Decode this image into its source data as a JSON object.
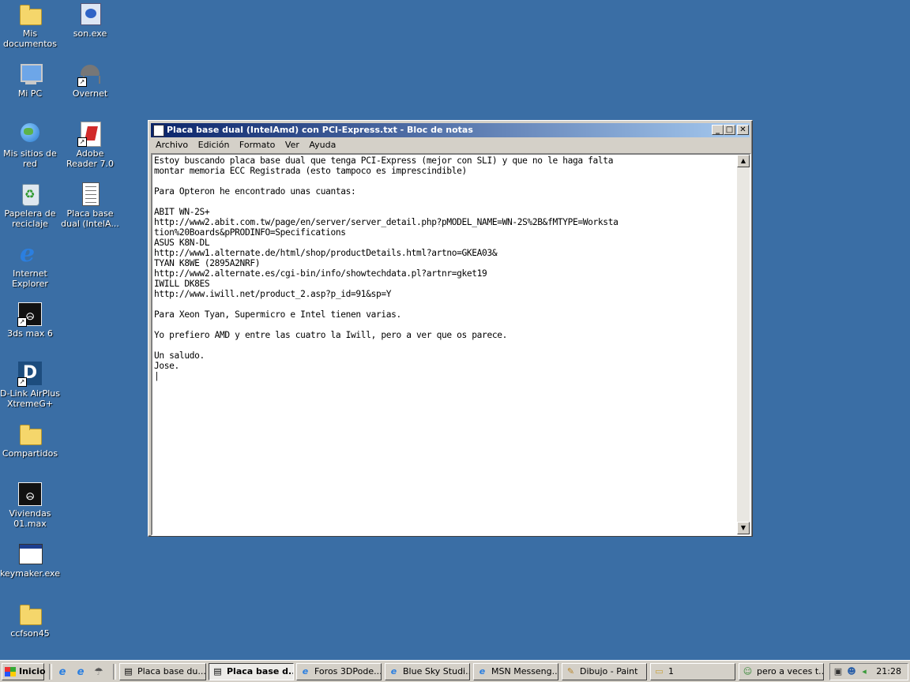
{
  "desktop_icons": [
    {
      "label": "Mis documentos",
      "icon": "folder-documents-icon"
    },
    {
      "label": "son.exe",
      "icon": "exe-icon"
    },
    {
      "label": "Mi PC",
      "icon": "computer-icon"
    },
    {
      "label": "Overnet",
      "icon": "overnet-icon"
    },
    {
      "label": "Mis sitios de red",
      "icon": "network-places-icon"
    },
    {
      "label": "Adobe Reader 7.0",
      "icon": "adobe-reader-icon"
    },
    {
      "label": "Papelera de reciclaje",
      "icon": "recycle-bin-icon"
    },
    {
      "label": "Placa base dual (IntelA...",
      "icon": "text-document-icon"
    },
    {
      "label": "Internet Explorer",
      "icon": "internet-explorer-icon"
    },
    {
      "label": "3ds max 6",
      "icon": "3ds-max-icon"
    },
    {
      "label": "D-Link AirPlus XtremeG+",
      "icon": "dlink-icon"
    },
    {
      "label": "Compartidos",
      "icon": "folder-icon"
    },
    {
      "label": "Viviendas 01.max",
      "icon": "max-file-icon"
    },
    {
      "label": "keymaker.exe",
      "icon": "application-icon"
    },
    {
      "label": "ccfson45",
      "icon": "folder-icon"
    }
  ],
  "window": {
    "title": "Placa base dual (IntelAmd) con PCI-Express.txt - Bloc de notas",
    "minimize_symbol": "_",
    "maximize_symbol": "□",
    "close_symbol": "✕",
    "menu": [
      "Archivo",
      "Edición",
      "Formato",
      "Ver",
      "Ayuda"
    ],
    "content": "Estoy buscando placa base dual que tenga PCI-Express (mejor con SLI) y que no le haga falta\nmontar memoria ECC Registrada (esto tampoco es imprescindible)\n\nPara Opteron he encontrado unas cuantas:\n\nABIT WN-2S+\nhttp://www2.abit.com.tw/page/en/server/server_detail.php?pMODEL_NAME=WN-2S%2B&fMTYPE=Worksta\ntion%20Boards&pPRODINFO=Specifications\nASUS K8N-DL\nhttp://www1.alternate.de/html/shop/productDetails.html?artno=GKEA03&\nTYAN K8WE (2895A2NRF)\nhttp://www2.alternate.es/cgi-bin/info/showtechdata.pl?artnr=gket19\nIWILL DK8ES\nhttp://www.iwill.net/product_2.asp?p_id=91&sp=Y\n\nPara Xeon Tyan, Supermicro e Intel tienen varias.\n\nYo prefiero AMD y entre las cuatro la Iwill, pero a ver que os parece.\n\nUn saludo.\nJose.\n|",
    "scroll_up_symbol": "▲",
    "scroll_down_symbol": "▼"
  },
  "taskbar": {
    "start_label": "Inicio",
    "quick_launch": [
      {
        "icon": "internet-explorer-icon",
        "glyph": "e"
      },
      {
        "icon": "browser-icon",
        "glyph": "e"
      },
      {
        "icon": "overnet-icon",
        "glyph": "☂"
      }
    ],
    "tasks": [
      {
        "label": "Placa base du...",
        "icon": "notepad-icon",
        "glyph": "▤",
        "active": false
      },
      {
        "label": "Placa base d...",
        "icon": "notepad-icon",
        "glyph": "▤",
        "active": true
      },
      {
        "label": "Foros 3DPode...",
        "icon": "internet-explorer-icon",
        "glyph": "e",
        "active": false
      },
      {
        "label": "Blue Sky Studi...",
        "icon": "internet-explorer-icon",
        "glyph": "e",
        "active": false
      },
      {
        "label": "MSN Messeng...",
        "icon": "internet-explorer-icon",
        "glyph": "e",
        "active": false
      },
      {
        "label": "Dibujo - Paint",
        "icon": "paint-icon",
        "glyph": "✎",
        "active": false
      },
      {
        "label": "1",
        "icon": "folder-icon",
        "glyph": "▭",
        "active": false
      },
      {
        "label": "pero a veces t...",
        "icon": "messenger-icon",
        "glyph": "☺",
        "active": false
      }
    ],
    "clock": "21:28"
  },
  "colors": {
    "desktop": "#3a6ea5",
    "titlebar_start": "#0a246a",
    "titlebar_end": "#a6caf0",
    "face": "#d4d0c8"
  }
}
